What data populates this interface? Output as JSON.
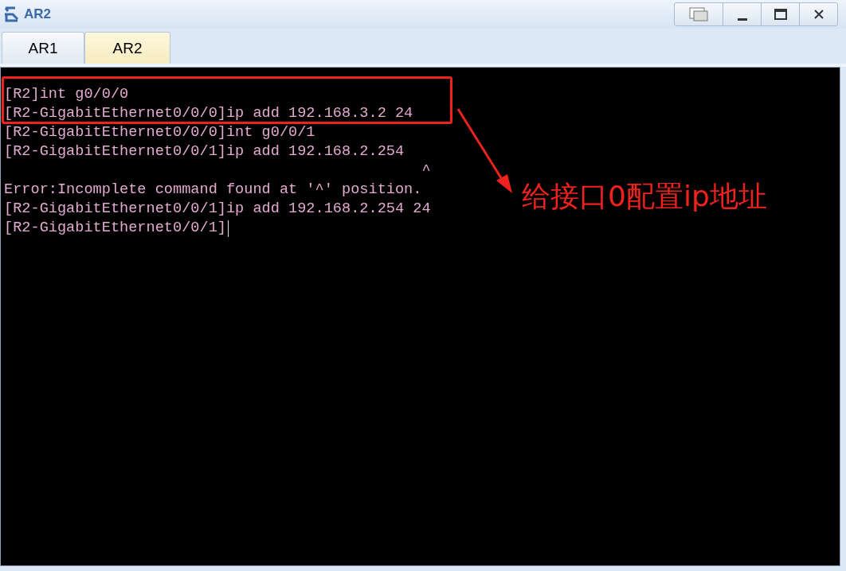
{
  "window": {
    "title": "AR2"
  },
  "tabs": [
    {
      "label": "AR1",
      "selected": false
    },
    {
      "label": "AR2",
      "selected": true
    }
  ],
  "terminal": {
    "lines": [
      "[R2]int g0/0/0",
      "[R2-GigabitEthernet0/0/0]ip add 192.168.3.2 24",
      "[R2-GigabitEthernet0/0/0]int g0/0/1",
      "[R2-GigabitEthernet0/0/1]ip add 192.168.2.254",
      "                                               ^",
      "Error:Incomplete command found at '^' position.",
      "[R2-GigabitEthernet0/0/1]ip add 192.168.2.254 24",
      "[R2-GigabitEthernet0/0/1]"
    ],
    "cursor": true
  },
  "annotation": {
    "text": "给接口0配置ip地址"
  }
}
